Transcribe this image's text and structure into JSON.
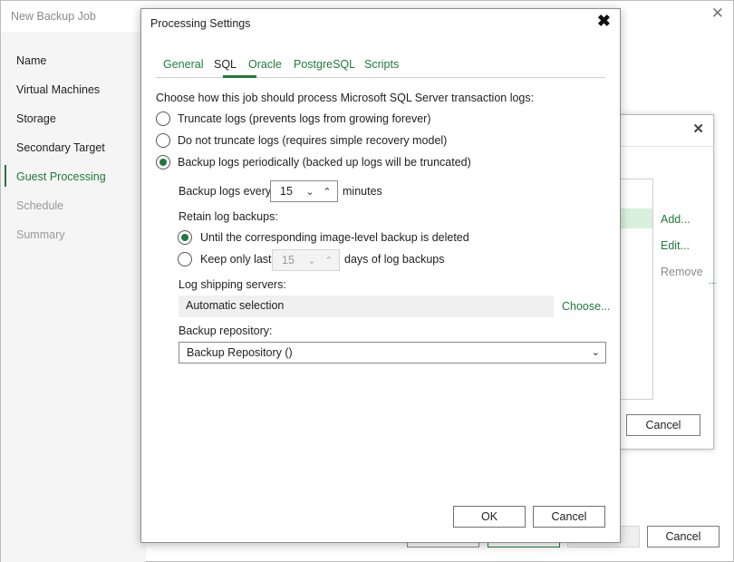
{
  "main": {
    "title": "New Backup Job",
    "close_glyph": "✕",
    "steps": [
      {
        "label": "Name",
        "state": "normal"
      },
      {
        "label": "Virtual Machines",
        "state": "normal"
      },
      {
        "label": "Storage",
        "state": "normal"
      },
      {
        "label": "Secondary Target",
        "state": "normal"
      },
      {
        "label": "Guest Processing",
        "state": "active"
      },
      {
        "label": "Schedule",
        "state": "disabled"
      },
      {
        "label": "Summary",
        "state": "disabled"
      }
    ],
    "cancel_label": "Cancel"
  },
  "mid_dialog": {
    "close_glyph": "✕",
    "add_label": "Add...",
    "edit_label": "Edit...",
    "remove_label": "Remove",
    "cancel_label": "Cancel"
  },
  "dialog": {
    "title": "Processing Settings",
    "close_glyph": "✖",
    "tabs": [
      "General",
      "SQL",
      "Oracle",
      "PostgreSQL",
      "Scripts"
    ],
    "active_tab": "SQL",
    "prompt": "Choose how this job should process Microsoft SQL Server transaction logs:",
    "options": {
      "truncate": "Truncate logs (prevents logs from growing forever)",
      "no_truncate": "Do not truncate logs (requires simple recovery model)",
      "backup_periodically": "Backup logs periodically (backed up logs will be truncated)"
    },
    "selected_option": "backup_periodically",
    "backup_every_label": "Backup logs every:",
    "backup_every_value": "15",
    "backup_every_unit": "minutes",
    "retain_label": "Retain log backups:",
    "retain_options": {
      "until_deleted": "Until the corresponding image-level backup is deleted",
      "keep_only_last": "Keep only last:"
    },
    "retain_selected": "until_deleted",
    "keep_last_value": "15",
    "keep_last_unit": "days of log backups",
    "log_shipping_label": "Log shipping servers:",
    "log_shipping_value": "Automatic selection",
    "choose_label": "Choose...",
    "repository_label": "Backup repository:",
    "repository_value": "Backup Repository ()",
    "ok_label": "OK",
    "cancel_label": "Cancel"
  },
  "colors": {
    "accent": "#1f7a3a",
    "selection": "#d8f0dc",
    "disabled_text": "#9a9a9a"
  },
  "icons": {
    "spinner_down": "chevron-down-icon",
    "spinner_up": "chevron-up-icon",
    "dropdown": "chevron-down-icon",
    "close": "close-icon"
  }
}
